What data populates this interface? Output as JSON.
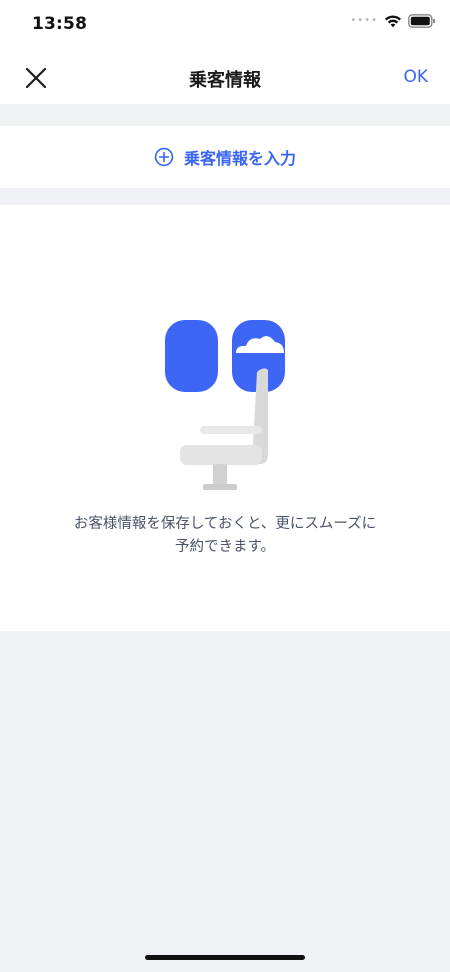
{
  "status_bar": {
    "time": "13:58",
    "icons": [
      "signal-dots-icon",
      "wifi-icon",
      "battery-icon"
    ]
  },
  "nav": {
    "title": "乗客情報",
    "close_icon": "close-icon",
    "ok_label": "OK"
  },
  "add_passenger": {
    "icon": "plus-circle-icon",
    "label": "乗客情報を入力"
  },
  "empty_state": {
    "illustration": "airplane-seat-window-illustration",
    "message_line1": "お客様情報を保存しておくと、更にスムーズに",
    "message_line2": "予約できます。"
  },
  "colors": {
    "accent": "#3a64f4",
    "illustration_blue": "#3d66f5",
    "background": "#f0f1f5",
    "text_secondary": "#4a5468"
  }
}
